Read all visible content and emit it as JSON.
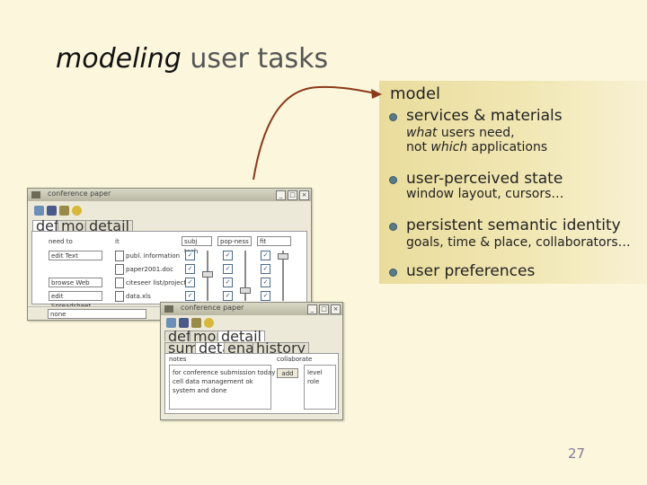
{
  "slide": {
    "title_em": "modeling",
    "title_rest": "user tasks",
    "page_number": "27"
  },
  "panel": {
    "heading": "model",
    "items": [
      {
        "label": "services & materials",
        "sub_line1_em": "what",
        "sub_line1_rest": " users need,",
        "sub_line2_pre": "not ",
        "sub_line2_em": "which",
        "sub_line2_rest": " applications"
      },
      {
        "label": "user-perceived state",
        "sub": "window layout, cursors…"
      },
      {
        "label": "persistent semantic identity",
        "sub": "goals, time & place, collaborators…"
      },
      {
        "label": "user preferences"
      }
    ]
  },
  "window1": {
    "title": "conference paper",
    "tabs": [
      "define",
      "monitor",
      "detail"
    ],
    "col_need": "need to",
    "col_it": "it",
    "dropdowns": [
      "subj tech",
      "pop-ness",
      "fit"
    ],
    "rows": [
      {
        "need": "edit Text",
        "doc": "publ. information"
      },
      {
        "need": "",
        "doc": "paper2001.doc"
      },
      {
        "need": "browse Web",
        "doc": "citeseer list/project"
      },
      {
        "need": "edit Spreadsheet",
        "doc": "data.xls"
      }
    ],
    "status": "none"
  },
  "window2": {
    "title": "conference paper",
    "tabs": [
      "define",
      "monitor",
      "detail"
    ],
    "subtabs": [
      "summary",
      "details",
      "enabled",
      "history"
    ],
    "notes_label": "notes",
    "notes_lines": [
      "for conference submission today",
      "cell data management ok",
      "system and done"
    ],
    "collab_label": "collaborate",
    "collab_btn": "add",
    "collab_items": [
      "level",
      "role"
    ]
  },
  "colors": {
    "background": "#fbf6dc",
    "panel": "#efe3a8",
    "arrow": "#8b3a1a",
    "bullet": "#5a7a88"
  }
}
